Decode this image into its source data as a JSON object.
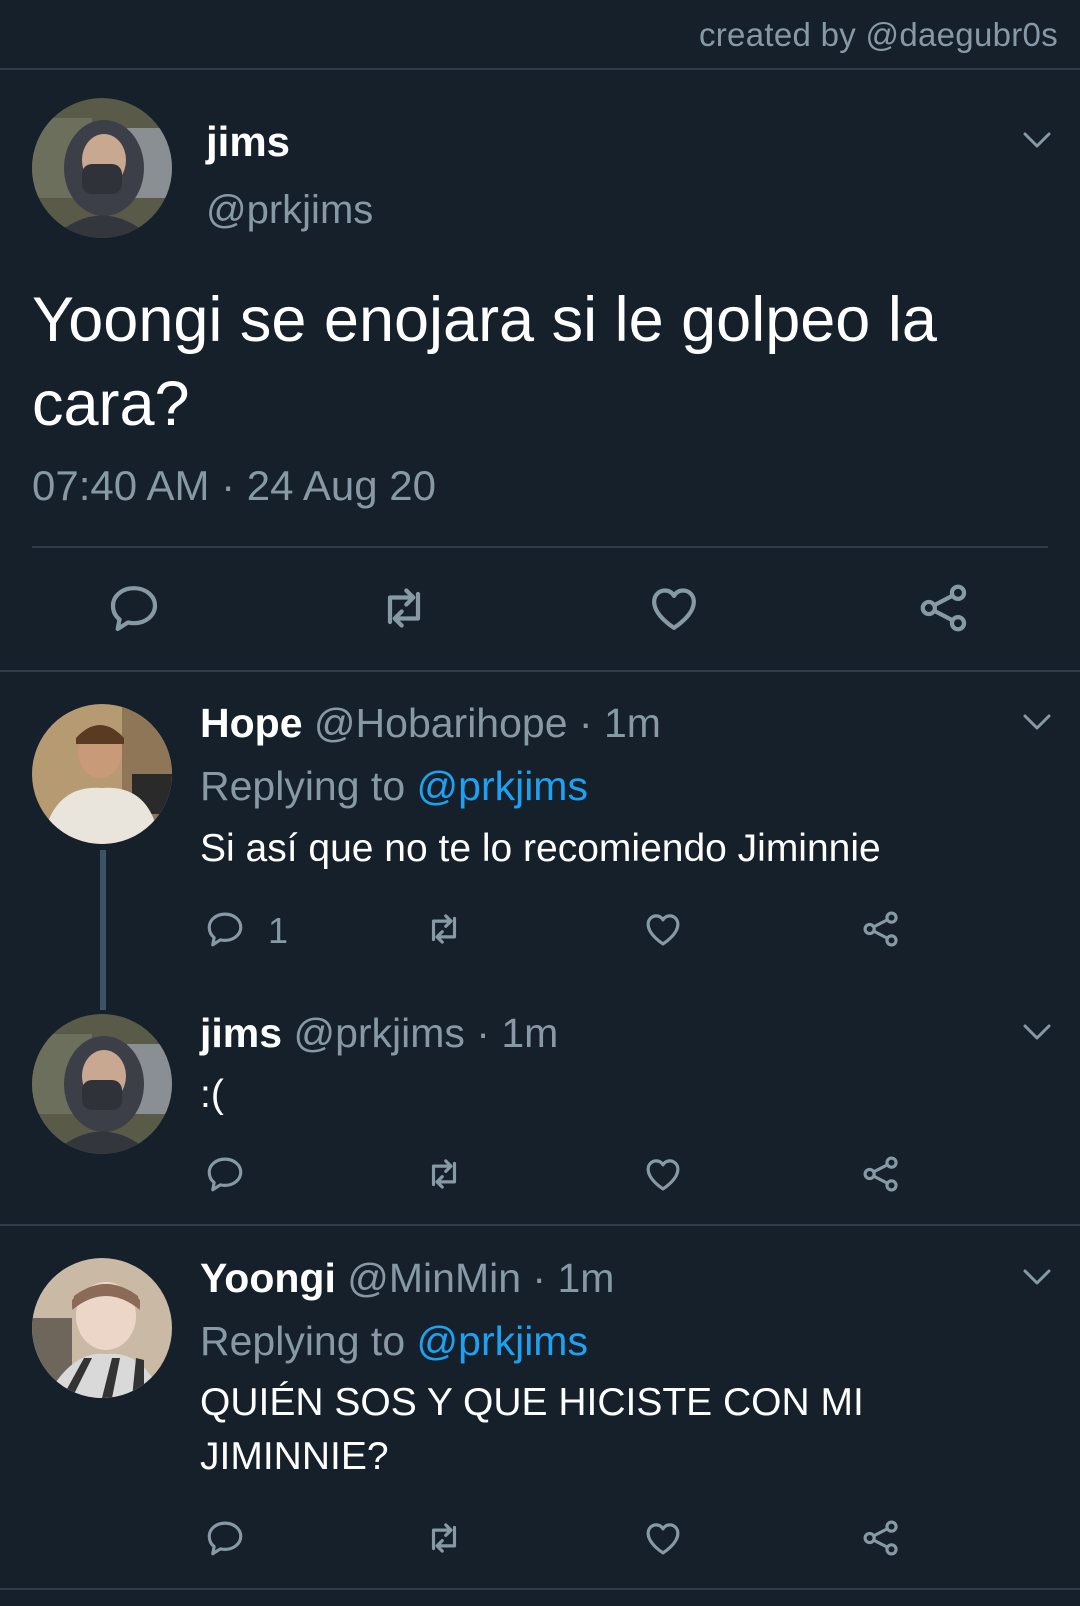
{
  "credit": "created by @daegubr0s",
  "main_tweet": {
    "name": "jims",
    "handle": "@prkjims",
    "text": "Yoongi se enojara si le golpeo la cara?",
    "time": "07:40 AM · 24 Aug 20"
  },
  "replies": [
    {
      "name": "Hope",
      "meta": "@Hobarihope · 1m",
      "replying_prefix": "Replying to ",
      "replying_to": "@prkjims",
      "text": "Si así que no te lo recomiendo Jiminnie",
      "reply_count": "1"
    },
    {
      "name": "jims",
      "meta": "@prkjims · 1m",
      "text": ":("
    },
    {
      "name": "Yoongi",
      "meta": "@MinMin · 1m",
      "replying_prefix": "Replying to ",
      "replying_to": "@prkjims",
      "text": "QUIÉN SOS Y QUE HICISTE CON MI JIMINNIE?"
    }
  ],
  "icons": [
    "reply-icon",
    "retweet-icon",
    "like-icon",
    "share-icon",
    "chevron-down-icon"
  ],
  "colors": {
    "background": "#15202b",
    "muted": "#8899a6",
    "link": "#1da1f2",
    "divider": "#2f3d4a"
  }
}
